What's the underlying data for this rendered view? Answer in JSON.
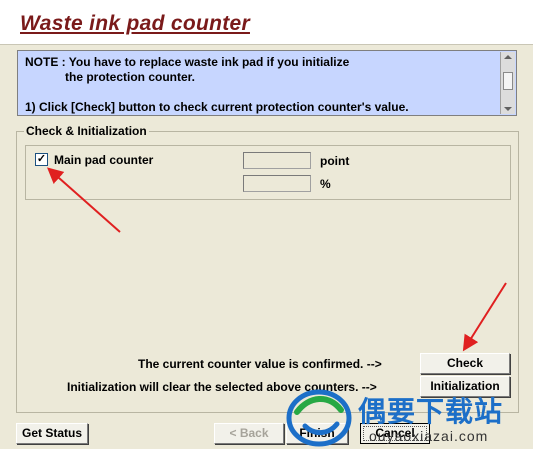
{
  "window": {
    "title": "Waste ink pad counter"
  },
  "note": {
    "lines": [
      "NOTE : You have to replace waste ink pad if you initialize",
      "            the protection counter.",
      "",
      "1) Click [Check] button to check current protection counter's value."
    ]
  },
  "group": {
    "label": "Check & Initialization",
    "main_pad_counter": {
      "label": "Main pad counter",
      "checked": true,
      "point_value": "",
      "percent_value": ""
    },
    "unit_point": "point",
    "unit_percent": "%"
  },
  "actions": {
    "confirm_text": "The current counter value is confirmed. -->",
    "check_label": "Check",
    "init_text": "Initialization will clear the selected above counters. -->",
    "init_label": "Initialization"
  },
  "footer": {
    "get_status": "Get Status",
    "back": "< Back",
    "finish": "Finish",
    "cancel": "Cancel"
  },
  "watermark": {
    "cn": "偶要下载站",
    "url": "ouyaoxiazai.com"
  },
  "colors": {
    "title": "#7a1a1a",
    "note_bg": "#c7d6ff",
    "dialog_bg": "#ece9d8",
    "arrow": "#e02020",
    "watermark": "#1c6fc8"
  }
}
